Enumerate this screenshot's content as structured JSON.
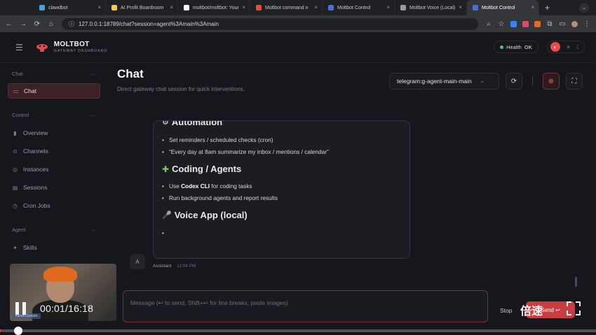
{
  "browser": {
    "tabs": [
      {
        "title": "clawdbot",
        "color": "#4aa3df"
      },
      {
        "title": "AI Profit Boardroom",
        "color": "#f2c94c"
      },
      {
        "title": "moltbot/moltbot: Your",
        "color": "#ffffff"
      },
      {
        "title": "Moltbot command n",
        "color": "#e74c3c"
      },
      {
        "title": "Moltbot Control",
        "color": "#4a6fd8"
      },
      {
        "title": "Moltbot Voice (Local)",
        "color": "#9a9a9a"
      },
      {
        "title": "Moltbot Control",
        "color": "#4a6fd8"
      }
    ],
    "url": "127.0.0.1:18789/chat?session=agent%3Amain%3Amain"
  },
  "header": {
    "brand_name": "MOLTBOT",
    "brand_sub": "GATEWAY DASHBOARD",
    "health_label": "Health",
    "health_status": "OK"
  },
  "sidebar": {
    "sections": [
      {
        "label": "Chat",
        "collapse": "—",
        "items": [
          {
            "label": "Chat",
            "icon": "chat-icon",
            "active": true
          }
        ]
      },
      {
        "label": "Control",
        "collapse": "—",
        "items": [
          {
            "label": "Overview",
            "icon": "bar-chart-icon"
          },
          {
            "label": "Channels",
            "icon": "link-icon"
          },
          {
            "label": "Instances",
            "icon": "radio-icon"
          },
          {
            "label": "Sessions",
            "icon": "document-icon"
          },
          {
            "label": "Cron Jobs",
            "icon": "clock-icon"
          }
        ]
      },
      {
        "label": "Agent",
        "collapse": "—",
        "items": [
          {
            "label": "Skills",
            "icon": "sparkle-icon"
          }
        ]
      }
    ]
  },
  "main": {
    "title": "Chat",
    "subtitle": "Direct gateway chat session for quick interventions.",
    "session_select": "telegram:g-agent-main-main"
  },
  "message": {
    "heading_partial": "Automation",
    "automation_items": [
      "Set reminders / scheduled checks (cron)",
      "“Every day at 8am summarize my inbox / mentions / calendar”"
    ],
    "coding_heading": "Coding / Agents",
    "coding_item1_pre": "Use ",
    "coding_item1_bold": "Codex CLI",
    "coding_item1_post": " for coding tasks",
    "coding_item2": "Run background agents and report results",
    "voice_heading": "Voice App (local)",
    "avatar_letter": "A",
    "sender": "Assistant",
    "time": "11:04 PM"
  },
  "composer": {
    "placeholder": "Message (↩ to send, Shift+↩ for line breaks, paste images)",
    "stop_label": "Stop",
    "send_label": "Send ↩"
  },
  "video": {
    "timecode": "00:01/16:18",
    "speed_label": "倍速",
    "pip_caption": "Kevin Gonzo",
    "progress": 0.001
  }
}
